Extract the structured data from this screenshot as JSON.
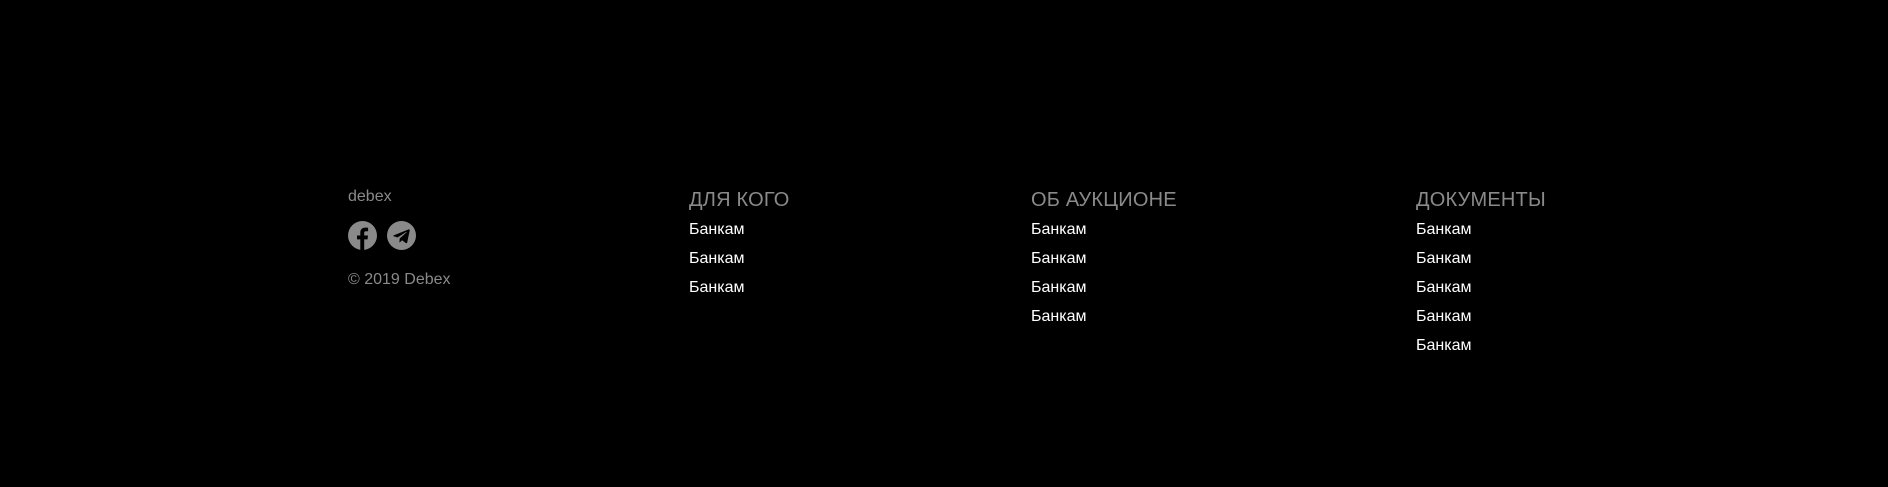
{
  "footer": {
    "brand": "debex",
    "socials": [
      {
        "icon": "facebook-icon",
        "color": "#8a8a8a"
      },
      {
        "icon": "telegram-icon",
        "color": "#8a8a8a"
      }
    ],
    "copyright": "© 2019 Debex",
    "columns": [
      {
        "heading": "ДЛЯ КОГО",
        "links": [
          "Банкам",
          "Банкам",
          "Банкам"
        ]
      },
      {
        "heading": "ОБ АУКЦИОНЕ",
        "links": [
          "Банкам",
          "Банкам",
          "Банкам",
          "Банкам"
        ]
      },
      {
        "heading": "ДОКУМЕНТЫ",
        "links": [
          "Банкам",
          "Банкам",
          "Банкам",
          "Банкам",
          "Банкам"
        ]
      }
    ]
  },
  "colors": {
    "background": "#000000",
    "muted_text": "#8a8a8a",
    "link_text": "#ffffff"
  }
}
